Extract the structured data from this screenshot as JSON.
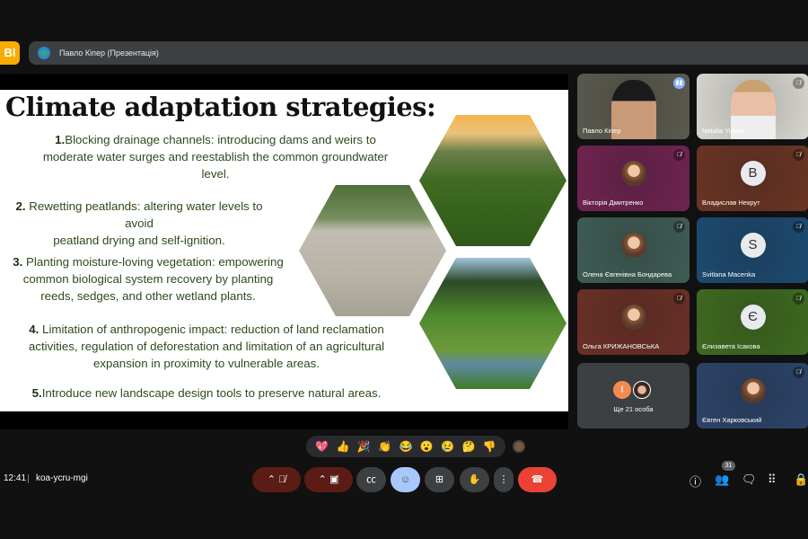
{
  "app": {
    "logo": "Bl",
    "presenter_banner": "Павло Кіпер (Презентація)"
  },
  "slide": {
    "title": "Climate adaptation strategies:",
    "points": [
      {
        "num": "1.",
        "text": "Blocking drainage channels: introducing dams and weirs to",
        "l2": "moderate water surges and reestablish the common groundwater",
        "l3": "level."
      },
      {
        "num": "2.",
        "text": " Rewetting peatlands: altering water levels to avoid",
        "l2": "peatland drying and self-ignition."
      },
      {
        "num": "3.",
        "text": " Planting moisture-loving vegetation: empowering",
        "l2": "common biological system recovery by planting",
        "l3": "reeds, sedges, and other wetland plants."
      },
      {
        "num": "4.",
        "text": " Limitation of anthropogenic impact: reduction of land reclamation",
        "l2": "activities, regulation of deforestation and limitation of an agricultural",
        "l3": "expansion in proximity to vulnerable areas."
      },
      {
        "num": "5.",
        "text": "Introduce new landscape design tools to preserve natural areas."
      }
    ]
  },
  "participants": [
    {
      "name": "Павло Кіпер",
      "initial": "",
      "color": "#5a5a50",
      "status": "speaking"
    },
    {
      "name": "Natalia Yuhan",
      "initial": "",
      "color": "#d8d6d0",
      "status": "muted"
    },
    {
      "name": "Вікторія Дмитренко",
      "initial": "",
      "color": "#6e2450",
      "status": "muted"
    },
    {
      "name": "Владислав Некрут",
      "initial": "B",
      "color": "#6a3424",
      "status": "muted"
    },
    {
      "name": "Олена Євгенівна Бондарева",
      "initial": "",
      "color": "#3f5c55",
      "status": "muted"
    },
    {
      "name": "Svitlana Macenka",
      "initial": "S",
      "color": "#1d4a70",
      "status": "muted"
    },
    {
      "name": "Ольга КРИЖАНОВСЬКА",
      "initial": "",
      "color": "#6a3026",
      "status": "muted"
    },
    {
      "name": "Єлизавета Ісакова",
      "initial": "Є",
      "color": "#3e6a20",
      "status": "muted"
    },
    {
      "name": "Євген Харковський",
      "initial": "",
      "color": "#2c4468",
      "status": "muted"
    }
  ],
  "others": {
    "label": "Ще 21 особа",
    "initial": "I"
  },
  "reactions": [
    "💖",
    "👍",
    "🎉",
    "👏",
    "😂",
    "😮",
    "😢",
    "🤔",
    "👎"
  ],
  "meeting": {
    "time": "12:41",
    "code": "koa-ycru-mgi",
    "participant_count": "31"
  }
}
